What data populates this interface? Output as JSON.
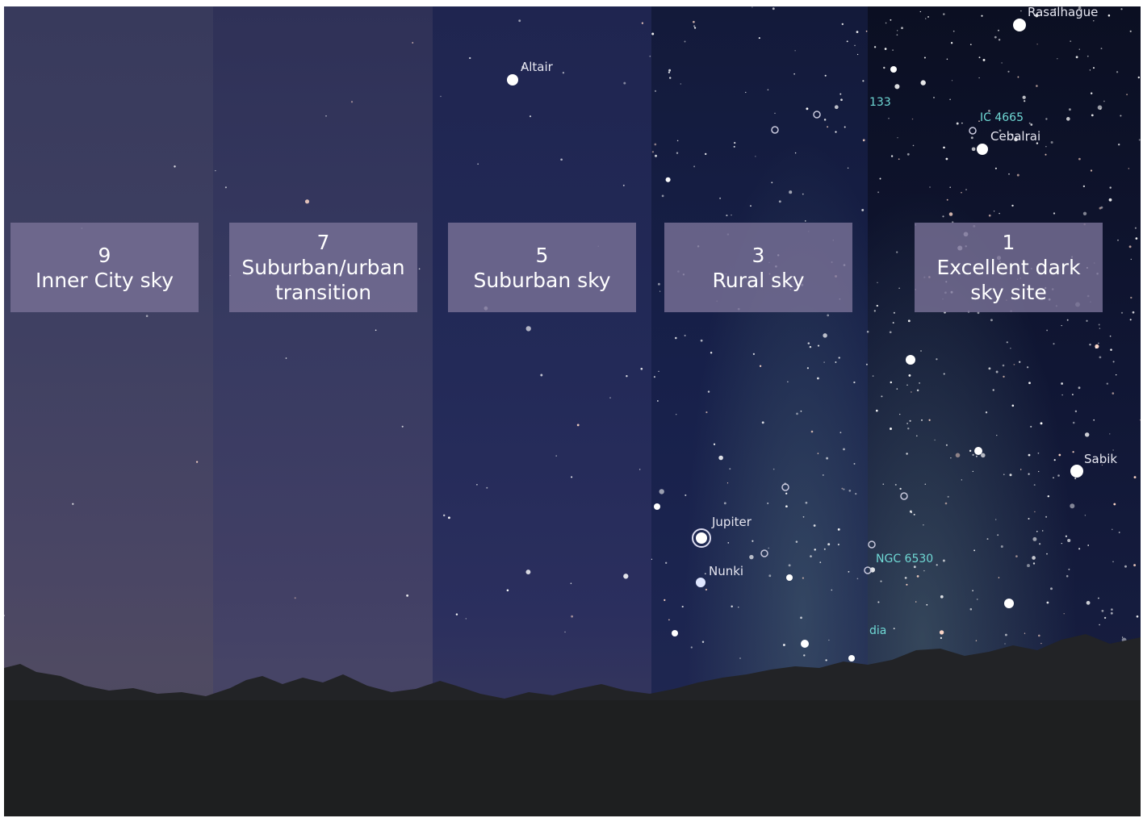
{
  "colors": {
    "label_box_bg": "#7870a0",
    "label_text": "#ffffff",
    "object_label": "#e6e6f0",
    "deep_sky_label": "#6fd8d4"
  },
  "scale": [
    {
      "id": "bortle-9",
      "number": "9",
      "lines": [
        "Inner City sky"
      ]
    },
    {
      "id": "bortle-7",
      "number": "7",
      "lines": [
        "Suburban/urban",
        "transition"
      ]
    },
    {
      "id": "bortle-5",
      "number": "5",
      "lines": [
        "Suburban sky"
      ]
    },
    {
      "id": "bortle-3",
      "number": "3",
      "lines": [
        "Rural sky"
      ]
    },
    {
      "id": "bortle-1",
      "number": "1",
      "lines": [
        "Excellent dark",
        "sky site"
      ]
    }
  ],
  "sky_objects": {
    "altair": "Altair",
    "rasalhague": "Rasalhague",
    "ngc_partial": "133",
    "ic_4665": "IC 4665",
    "cebalrai": "Cebalrai",
    "sabik": "Sabik",
    "jupiter": "Jupiter",
    "nunki": "Nunki",
    "ngc_6530": "NGC 6530",
    "lagoon_partial": "dia"
  }
}
